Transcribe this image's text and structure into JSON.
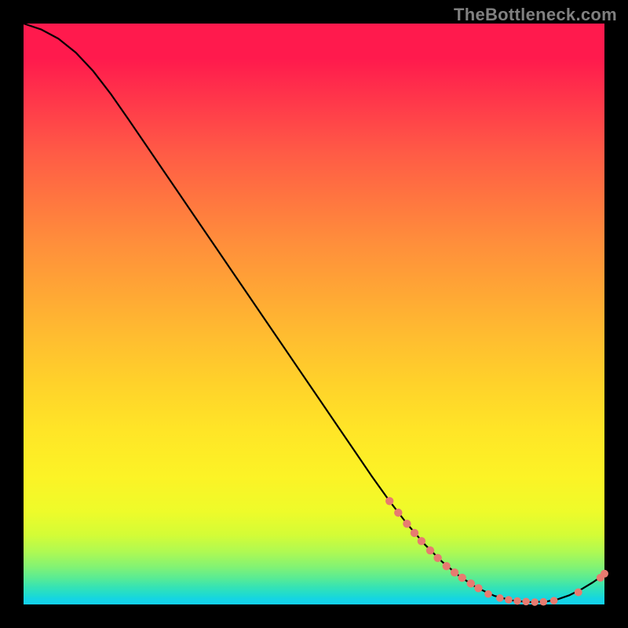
{
  "watermark": "TheBottleneck.com",
  "colors": {
    "black": "#000000",
    "marker": "#e77b70",
    "curve": "#000000",
    "gradient_top": "#ff1a4d",
    "gradient_mid": "#ffd22a",
    "gradient_bottom": "#13d2ef"
  },
  "chart_data": {
    "type": "line",
    "title": "",
    "xlabel": "",
    "ylabel": "",
    "xlim": [
      0,
      100
    ],
    "ylim": [
      0,
      100
    ],
    "note": "x and y in percent of plot area; y=100 at top, y=0 at bottom; curve descends from top-left, reaches minimum ~x=83–92, rises slightly at far right. Markers highlight low-y segment.",
    "curve": [
      {
        "x": 0.0,
        "y": 100.0
      },
      {
        "x": 3.0,
        "y": 99.0
      },
      {
        "x": 6.0,
        "y": 97.4
      },
      {
        "x": 9.0,
        "y": 95.0
      },
      {
        "x": 12.0,
        "y": 91.8
      },
      {
        "x": 15.0,
        "y": 87.9
      },
      {
        "x": 18.0,
        "y": 83.6
      },
      {
        "x": 21.0,
        "y": 79.2
      },
      {
        "x": 24.0,
        "y": 74.8
      },
      {
        "x": 27.0,
        "y": 70.4
      },
      {
        "x": 30.0,
        "y": 66.0
      },
      {
        "x": 33.0,
        "y": 61.6
      },
      {
        "x": 36.0,
        "y": 57.2
      },
      {
        "x": 39.0,
        "y": 52.8
      },
      {
        "x": 42.0,
        "y": 48.4
      },
      {
        "x": 45.0,
        "y": 44.0
      },
      {
        "x": 48.0,
        "y": 39.6
      },
      {
        "x": 51.0,
        "y": 35.2
      },
      {
        "x": 54.0,
        "y": 30.8
      },
      {
        "x": 57.0,
        "y": 26.4
      },
      {
        "x": 60.0,
        "y": 22.0
      },
      {
        "x": 63.0,
        "y": 17.8
      },
      {
        "x": 66.0,
        "y": 13.9
      },
      {
        "x": 69.0,
        "y": 10.4
      },
      {
        "x": 72.0,
        "y": 7.4
      },
      {
        "x": 75.0,
        "y": 4.9
      },
      {
        "x": 78.0,
        "y": 2.9
      },
      {
        "x": 81.0,
        "y": 1.5
      },
      {
        "x": 84.0,
        "y": 0.7
      },
      {
        "x": 87.0,
        "y": 0.4
      },
      {
        "x": 90.0,
        "y": 0.5
      },
      {
        "x": 92.0,
        "y": 0.9
      },
      {
        "x": 94.0,
        "y": 1.6
      },
      {
        "x": 96.0,
        "y": 2.6
      },
      {
        "x": 98.0,
        "y": 3.8
      },
      {
        "x": 100.0,
        "y": 5.2
      }
    ],
    "markers": [
      {
        "x": 63.0,
        "y": 17.8,
        "r": 5.2
      },
      {
        "x": 64.5,
        "y": 15.8,
        "r": 5.2
      },
      {
        "x": 66.0,
        "y": 13.9,
        "r": 5.2
      },
      {
        "x": 67.3,
        "y": 12.3,
        "r": 5.2
      },
      {
        "x": 68.5,
        "y": 10.9,
        "r": 5.2
      },
      {
        "x": 70.0,
        "y": 9.3,
        "r": 5.2
      },
      {
        "x": 71.3,
        "y": 8.0,
        "r": 5.2
      },
      {
        "x": 72.8,
        "y": 6.6,
        "r": 5.2
      },
      {
        "x": 74.2,
        "y": 5.5,
        "r": 5.2
      },
      {
        "x": 75.5,
        "y": 4.6,
        "r": 5.2
      },
      {
        "x": 77.0,
        "y": 3.6,
        "r": 5.2
      },
      {
        "x": 78.3,
        "y": 2.8,
        "r": 5.2
      },
      {
        "x": 80.0,
        "y": 1.8,
        "r": 4.8
      },
      {
        "x": 82.0,
        "y": 1.1,
        "r": 4.8
      },
      {
        "x": 83.5,
        "y": 0.8,
        "r": 4.8
      },
      {
        "x": 85.0,
        "y": 0.6,
        "r": 4.8
      },
      {
        "x": 86.5,
        "y": 0.5,
        "r": 4.8
      },
      {
        "x": 88.0,
        "y": 0.4,
        "r": 4.8
      },
      {
        "x": 89.5,
        "y": 0.45,
        "r": 4.8
      },
      {
        "x": 91.3,
        "y": 0.65,
        "r": 4.8
      },
      {
        "x": 95.5,
        "y": 2.1,
        "r": 5.0
      },
      {
        "x": 99.3,
        "y": 4.6,
        "r": 5.0
      },
      {
        "x": 100.0,
        "y": 5.3,
        "r": 5.0
      }
    ]
  }
}
